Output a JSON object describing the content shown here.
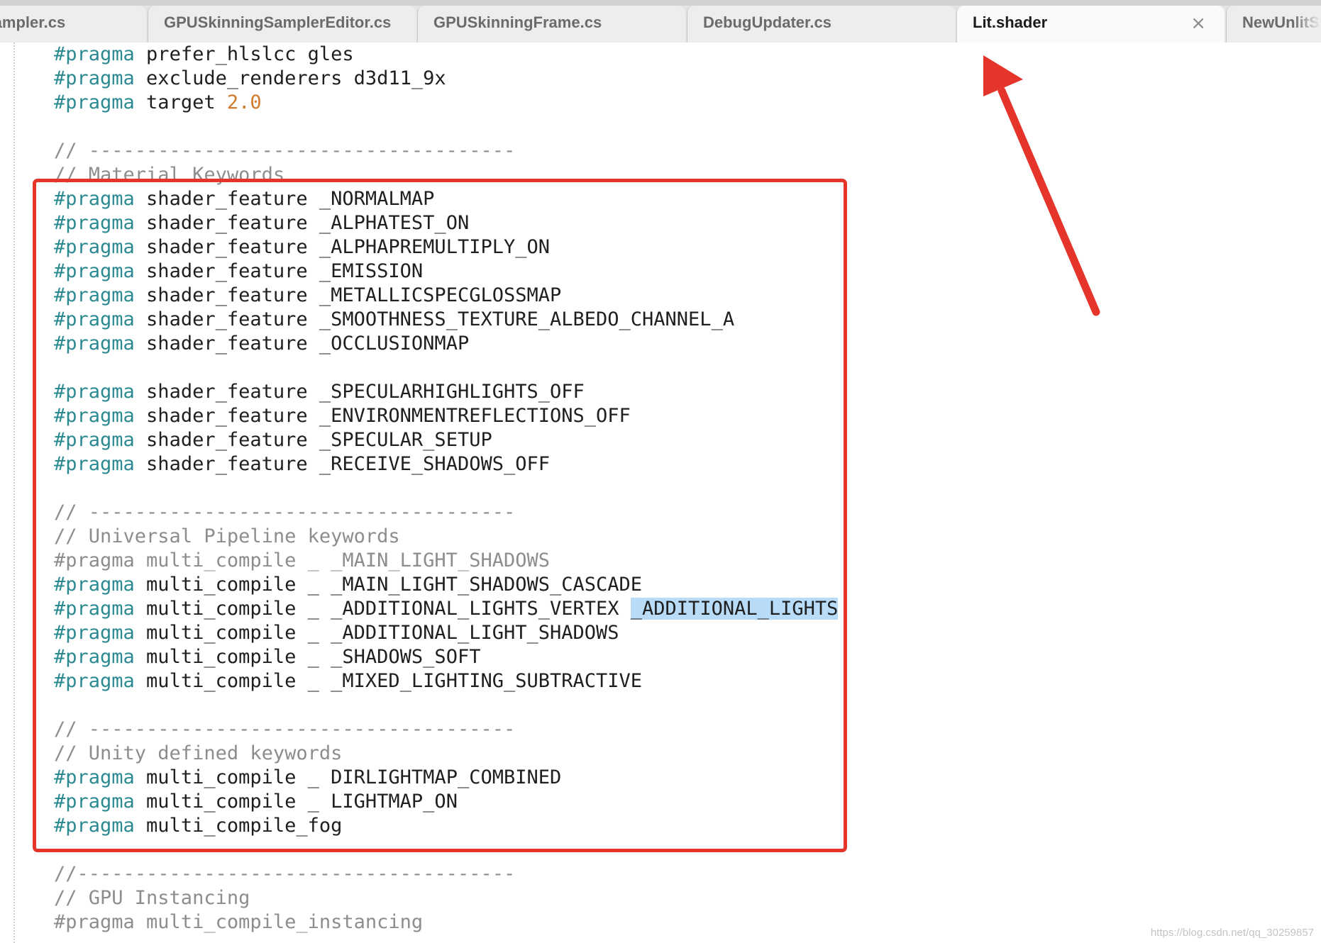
{
  "tabs": [
    {
      "label": "Sampler.cs",
      "active": false
    },
    {
      "label": "GPUSkinningSamplerEditor.cs",
      "active": false
    },
    {
      "label": "GPUSkinningFrame.cs",
      "active": false
    },
    {
      "label": "DebugUpdater.cs",
      "active": false
    },
    {
      "label": "Lit.shader",
      "active": true,
      "close_glyph": "×"
    },
    {
      "label": "NewUnlitS",
      "active": false
    }
  ],
  "code_lines": [
    [
      {
        "t": "#pragma",
        "c": "kw"
      },
      {
        "t": " prefer_hlslcc gles"
      }
    ],
    [
      {
        "t": "#pragma",
        "c": "kw"
      },
      {
        "t": " exclude_renderers d3d11_9x"
      }
    ],
    [
      {
        "t": "#pragma",
        "c": "kw"
      },
      {
        "t": " target "
      },
      {
        "t": "2.0",
        "c": "num"
      }
    ],
    [],
    [
      {
        "t": "// -------------------------------------",
        "c": "cmt"
      }
    ],
    [
      {
        "t": "// Material Keywords",
        "c": "cmt"
      }
    ],
    [
      {
        "t": "#pragma",
        "c": "kw"
      },
      {
        "t": " shader_feature _NORMALMAP"
      }
    ],
    [
      {
        "t": "#pragma",
        "c": "kw"
      },
      {
        "t": " shader_feature _ALPHATEST_ON"
      }
    ],
    [
      {
        "t": "#pragma",
        "c": "kw"
      },
      {
        "t": " shader_feature _ALPHAPREMULTIPLY_ON"
      }
    ],
    [
      {
        "t": "#pragma",
        "c": "kw"
      },
      {
        "t": " shader_feature _EMISSION"
      }
    ],
    [
      {
        "t": "#pragma",
        "c": "kw"
      },
      {
        "t": " shader_feature _METALLICSPECGLOSSMAP"
      }
    ],
    [
      {
        "t": "#pragma",
        "c": "kw"
      },
      {
        "t": " shader_feature _SMOOTHNESS_TEXTURE_ALBEDO_CHANNEL_A"
      }
    ],
    [
      {
        "t": "#pragma",
        "c": "kw"
      },
      {
        "t": " shader_feature _OCCLUSIONMAP"
      }
    ],
    [],
    [
      {
        "t": "#pragma",
        "c": "kw"
      },
      {
        "t": " shader_feature _SPECULARHIGHLIGHTS_OFF"
      }
    ],
    [
      {
        "t": "#pragma",
        "c": "kw"
      },
      {
        "t": " shader_feature _ENVIRONMENTREFLECTIONS_OFF"
      }
    ],
    [
      {
        "t": "#pragma",
        "c": "kw"
      },
      {
        "t": " shader_feature _SPECULAR_SETUP"
      }
    ],
    [
      {
        "t": "#pragma",
        "c": "kw"
      },
      {
        "t": " shader_feature _RECEIVE_SHADOWS_OFF"
      }
    ],
    [],
    [
      {
        "t": "// -------------------------------------",
        "c": "cmt"
      }
    ],
    [
      {
        "t": "// Universal Pipeline keywords",
        "c": "cmt"
      }
    ],
    [
      {
        "t": "#pragma multi_compile _ _MAIN_LIGHT_SHADOWS",
        "c": "cmt"
      }
    ],
    [
      {
        "t": "#pragma",
        "c": "kw"
      },
      {
        "t": " multi_compile _ _MAIN_LIGHT_SHADOWS_CASCADE"
      }
    ],
    [
      {
        "t": "#pragma",
        "c": "kw"
      },
      {
        "t": " multi_compile _ _ADDITIONAL_LIGHTS_VERTEX "
      },
      {
        "t": "_ADDITIONAL_LIGHTS",
        "c": "hl"
      }
    ],
    [
      {
        "t": "#pragma",
        "c": "kw"
      },
      {
        "t": " multi_compile _ _ADDITIONAL_LIGHT_SHADOWS"
      }
    ],
    [
      {
        "t": "#pragma",
        "c": "kw"
      },
      {
        "t": " multi_compile _ _SHADOWS_SOFT"
      }
    ],
    [
      {
        "t": "#pragma",
        "c": "kw"
      },
      {
        "t": " multi_compile _ _MIXED_LIGHTING_SUBTRACTIVE"
      }
    ],
    [],
    [
      {
        "t": "// -------------------------------------",
        "c": "cmt"
      }
    ],
    [
      {
        "t": "// Unity defined keywords",
        "c": "cmt"
      }
    ],
    [
      {
        "t": "#pragma",
        "c": "kw"
      },
      {
        "t": " multi_compile _ DIRLIGHTMAP_COMBINED"
      }
    ],
    [
      {
        "t": "#pragma",
        "c": "kw"
      },
      {
        "t": " multi_compile _ LIGHTMAP_ON"
      }
    ],
    [
      {
        "t": "#pragma",
        "c": "kw"
      },
      {
        "t": " multi_compile_fog"
      }
    ],
    [],
    [
      {
        "t": "//--------------------------------------",
        "c": "cmt"
      }
    ],
    [
      {
        "t": "// GPU Instancing",
        "c": "cmt"
      }
    ],
    [
      {
        "t": "#pragma multi_compile_instancing",
        "c": "cmt"
      }
    ]
  ],
  "watermark": "https://blog.csdn.net/qq_30259857",
  "colors": {
    "keyword": "#2b8a91",
    "number": "#d07a2c",
    "comment": "#8d8d8d",
    "selection": "#b8dcf7",
    "annotation": "#e5352b"
  }
}
